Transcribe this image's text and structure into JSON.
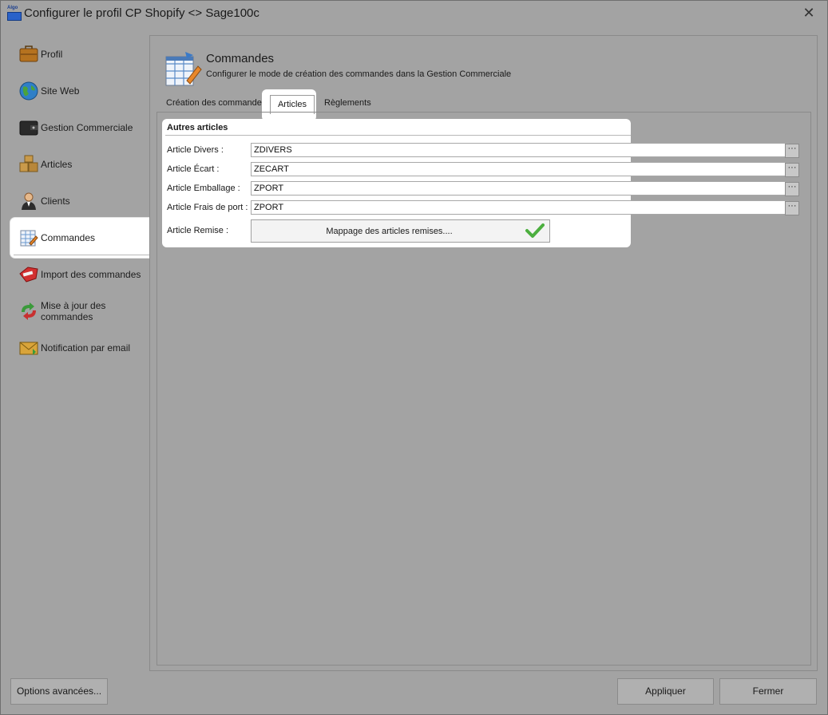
{
  "window": {
    "title": "Configurer le profil CP Shopify <> Sage100c",
    "app_icon_text": "Algo",
    "close_glyph": "✕"
  },
  "sidebar": {
    "items": [
      {
        "label": "Profil",
        "icon": "briefcase-icon",
        "active": false
      },
      {
        "label": "Site Web",
        "icon": "globe-icon",
        "active": false
      },
      {
        "label": "Gestion Commerciale",
        "icon": "wallet-icon",
        "active": false
      },
      {
        "label": "Articles",
        "icon": "boxes-icon",
        "active": false
      },
      {
        "label": "Clients",
        "icon": "person-icon",
        "active": false
      },
      {
        "label": "Commandes",
        "icon": "order-sheet-icon",
        "active": true
      },
      {
        "label": "Import des commandes",
        "icon": "sale-tag-icon",
        "active": false
      },
      {
        "label": "Mise à jour des commandes",
        "icon": "sync-arrows-icon",
        "active": false
      },
      {
        "label": "Notification par email",
        "icon": "envelope-icon",
        "active": false
      }
    ]
  },
  "header": {
    "title": "Commandes",
    "subtitle": "Configurer le mode de création des commandes dans la Gestion Commerciale"
  },
  "tabs": [
    {
      "label": "Création des commandes",
      "active": false
    },
    {
      "label": "Articles",
      "active": true
    },
    {
      "label": "Règlements",
      "active": false
    }
  ],
  "group": {
    "title": "Autres articles",
    "fields": [
      {
        "label": "Article Divers :",
        "value": "ZDIVERS"
      },
      {
        "label": "Article Écart :",
        "value": "ZECART"
      },
      {
        "label": "Article Emballage :",
        "value": "ZPORT"
      },
      {
        "label": "Article Frais de port :",
        "value": "ZPORT"
      }
    ],
    "ellipsis_glyph": "···",
    "remise": {
      "label": "Article Remise :",
      "button_label": "Mappage des articles remises...."
    }
  },
  "footer": {
    "advanced_label": "Options avancées...",
    "apply_label": "Appliquer",
    "close_label": "Fermer"
  },
  "colors": {
    "accent_check": "#4caf3f",
    "selection_bg": "#ffffff",
    "dim_bg": "#a3a3a3"
  }
}
